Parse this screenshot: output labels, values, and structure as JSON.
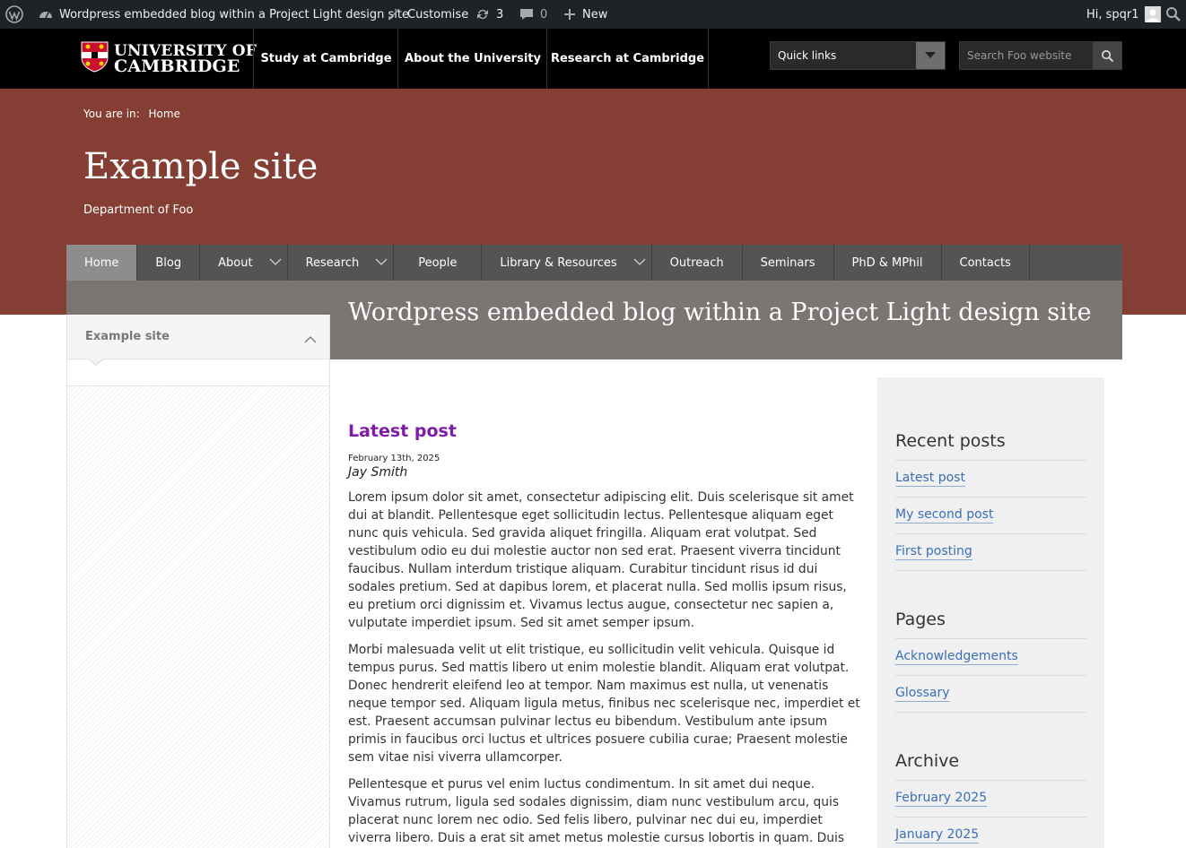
{
  "adminbar": {
    "site_name": "Wordpress embedded blog within a Project Light design site",
    "customise": "Customise",
    "updates_count": "3",
    "comments_count": "0",
    "new_label": "New",
    "greeting": "Hi, spqr1",
    "icons": [
      "wordpress-logo-icon",
      "dashboard-icon",
      "brush-icon",
      "refresh-icon",
      "comment-icon",
      "plus-icon",
      "avatar",
      "search-icon"
    ]
  },
  "header": {
    "logo_line1": "UNIVERSITY OF",
    "logo_line2": "CAMBRIDGE",
    "nav": [
      "Study at Cambridge",
      "About the University",
      "Research at Cambridge"
    ],
    "quicklinks_label": "Quick links",
    "search_placeholder": "Search Foo website"
  },
  "banner": {
    "breadcrumb_label": "You are in:",
    "breadcrumb_home": "Home",
    "site_title": "Example site",
    "site_subtitle": "Department of Foo",
    "color": "#853e33"
  },
  "mainnav": {
    "items": [
      {
        "label": "Home",
        "active": true,
        "dropdown": false
      },
      {
        "label": "Blog",
        "active": false,
        "dropdown": false
      },
      {
        "label": "About",
        "active": false,
        "dropdown": true
      },
      {
        "label": "Research",
        "active": false,
        "dropdown": true
      },
      {
        "label": "People",
        "active": false,
        "dropdown": false
      },
      {
        "label": "Library & Resources",
        "active": false,
        "dropdown": true
      },
      {
        "label": "Outreach",
        "active": false,
        "dropdown": false
      },
      {
        "label": "Seminars",
        "active": false,
        "dropdown": false
      },
      {
        "label": "PhD & MPhil",
        "active": false,
        "dropdown": false
      },
      {
        "label": "Contacts",
        "active": false,
        "dropdown": false
      }
    ]
  },
  "page": {
    "title": "Wordpress embedded blog within a Project Light design site"
  },
  "leftnav": {
    "heading": "Example site"
  },
  "post": {
    "title": "Latest post",
    "date": "February 13th, 2025",
    "author": "Jay Smith",
    "paragraphs": [
      "Lorem ipsum dolor sit amet, consectetur adipiscing elit. Duis scelerisque sit amet dui at blandit. Pellentesque eget sollicitudin lectus. Pellentesque aliquam eget nunc quis vehicula. Sed gravida aliquet fringilla. Aliquam erat volutpat. Sed vestibulum odio eu dui molestie auctor non sed erat. Praesent viverra tincidunt faucibus. Nullam interdum tristique aliquam. Curabitur tincidunt risus id dui sodales pretium. Sed at dapibus lorem, et placerat nulla. Sed mollis ipsum risus, eu pretium orci dignissim et. Vivamus lectus augue, consectetur nec sapien a, vulputate imperdiet ipsum. Sed sit amet semper ipsum.",
      "Morbi malesuada velit ut elit tristique, eu sollicitudin velit vehicula. Quisque id tempus purus. Sed mattis libero ut enim molestie blandit. Aliquam erat volutpat. Donec hendrerit eleifend leo at tempor. Nam maximus est nulla, ut venenatis neque tempor sed. Aliquam ligula metus, finibus nec scelerisque nec, imperdiet et est. Praesent accumsan pulvinar lectus eu bibendum. Vestibulum ante ipsum primis in faucibus orci luctus et ultrices posuere cubilia curae; Praesent molestie sem vitae nisi viverra ullamcorper.",
      "Pellentesque et purus vel enim luctus condimentum. In sit amet dui neque. Vivamus rutrum, ligula sed sodales dignissim, diam nunc vestibulum arcu, quis placerat nunc lorem nec odio. Sed felis libero, pulvinar nec dui eu, imperdiet viverra libero. Duis a erat sit amet metus molestie cursus lobortis in quam. Duis eget nunc tempor, lacinia"
    ]
  },
  "sidebar": {
    "recent_heading": "Recent posts",
    "recent": [
      "Latest post",
      "My second post",
      "First posting"
    ],
    "pages_heading": "Pages",
    "pages": [
      "Acknowledgements",
      "Glossary"
    ],
    "archive_heading": "Archive",
    "archive": [
      "February 2025",
      "January 2025"
    ]
  }
}
